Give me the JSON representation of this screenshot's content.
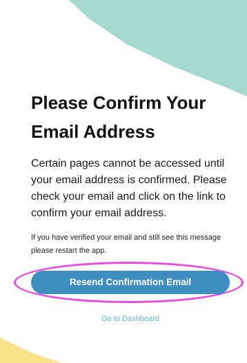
{
  "colors": {
    "accent_teal": "#a6d9d0",
    "accent_yellow": "#f8e38a",
    "button_blue": "#3e8fc0",
    "link_teal": "#63b4c8",
    "highlight_magenta": "#e44be0"
  },
  "confirm_email": {
    "title": "Please Confirm Your Email Address",
    "message": "Certain pages cannot be accessed until your email address is confirmed. Please check your email and click on the link to confirm your email address.",
    "note": "If you have verified your email and still see this message please restart the app.",
    "resend_button_label": "Resend Confirmation Email",
    "dashboard_link_label": "Go to Dashboard"
  }
}
